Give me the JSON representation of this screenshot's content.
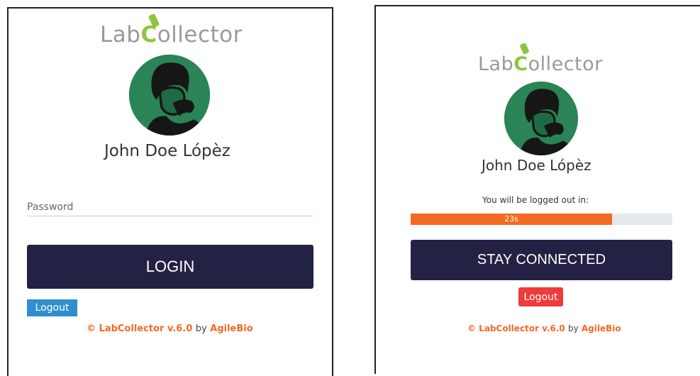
{
  "login_panel": {
    "logo": {
      "prefix": "Lab",
      "mark": "C",
      "suffix": "ollector"
    },
    "username": "John Doe Lópèz",
    "password_placeholder": "Password",
    "login_label": "LOGIN",
    "logout_label": "Logout",
    "footer": {
      "brand": "© LabCollector v.6.0",
      "by": "by",
      "company": "AgileBio"
    }
  },
  "timeout_panel": {
    "logo": {
      "prefix": "Lab",
      "mark": "C",
      "suffix": "ollector"
    },
    "username": "John Doe Lópèz",
    "message": "You will be logged out in:",
    "countdown": "23s",
    "progress_fraction": 0.77,
    "stay_label": "STAY CONNECTED",
    "logout_label": "Logout",
    "footer": {
      "brand": "© LabCollector v.6.0",
      "by": "by",
      "company": "AgileBio"
    }
  },
  "colors": {
    "brand_green": "#8cc63f",
    "button_navy": "#242244",
    "accent_orange": "#f26a22",
    "logout_blue": "#2f8fce",
    "logout_red": "#ee3b3b"
  }
}
